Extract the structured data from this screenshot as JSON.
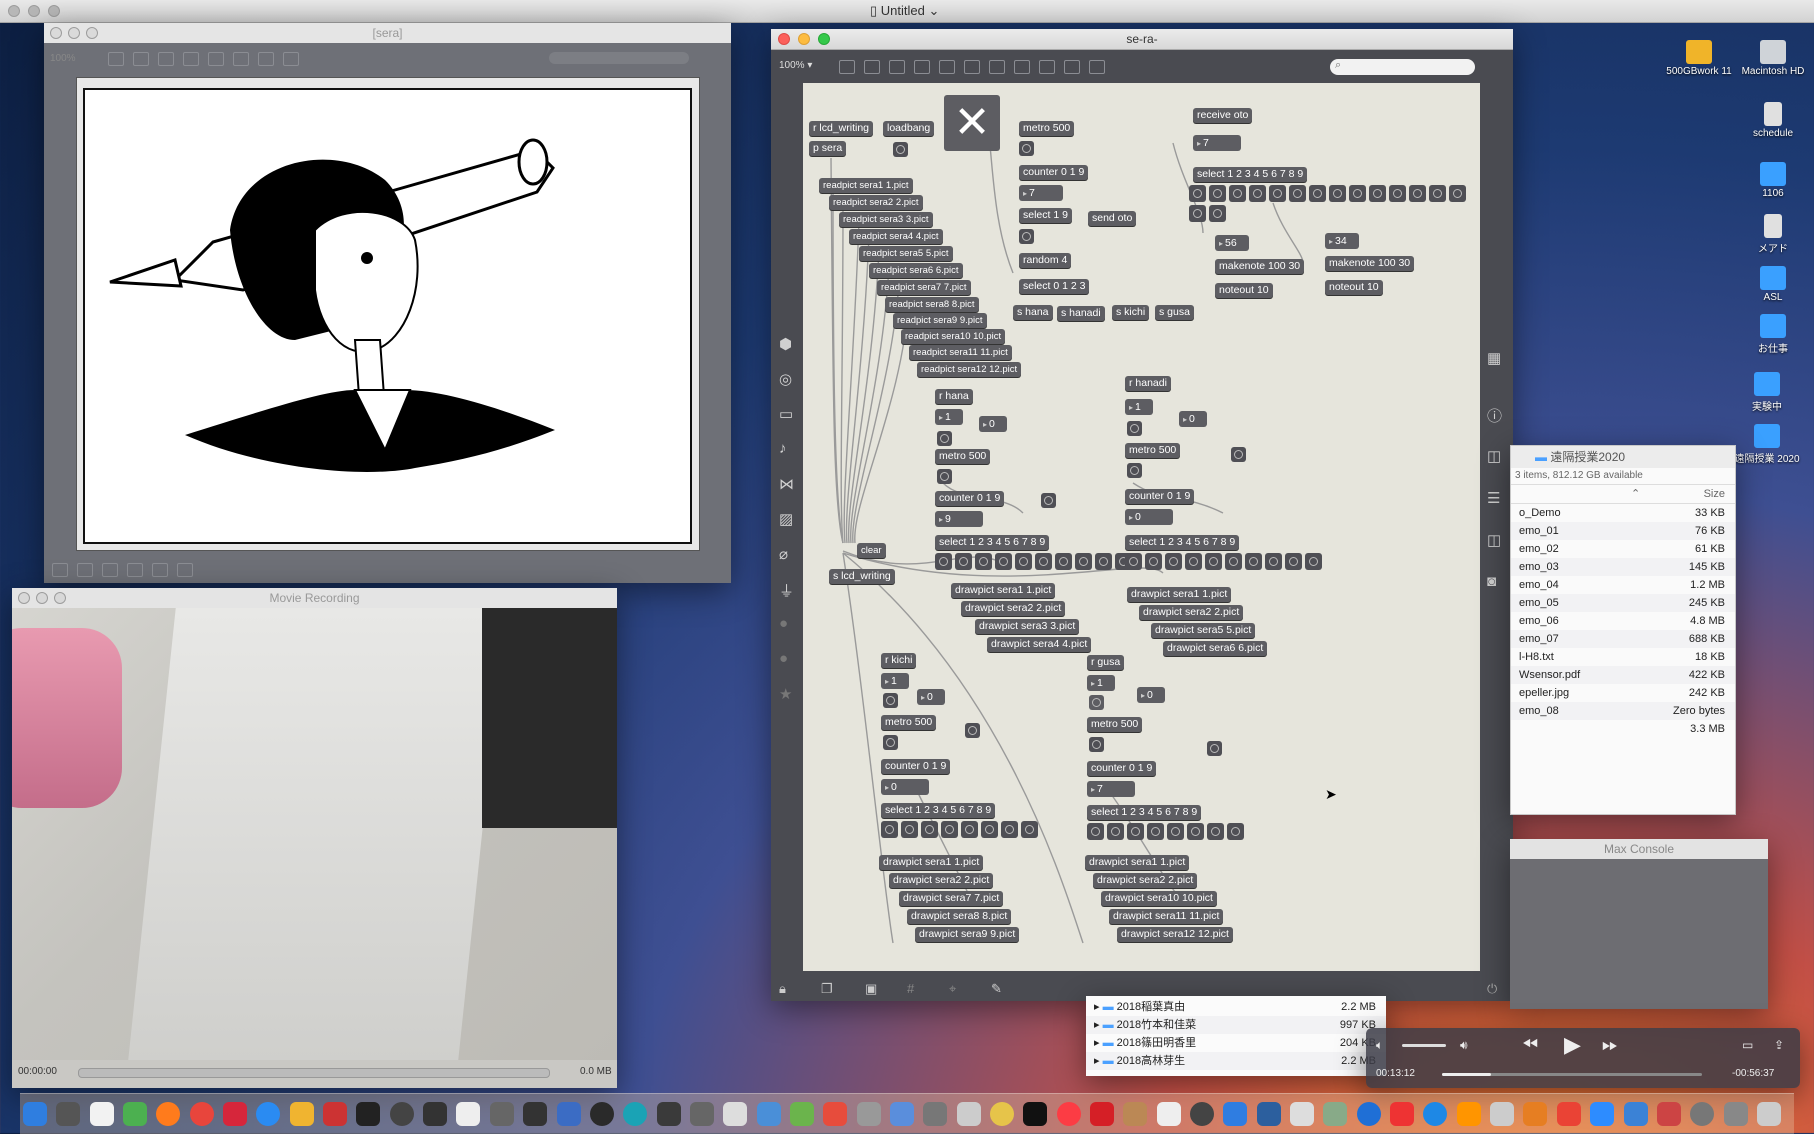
{
  "menubar": {
    "title": "Untitled",
    "chevron": "⌄"
  },
  "sera_window": {
    "title": "[sera]",
    "zoom": "100%"
  },
  "patcher": {
    "title": "se-ra-",
    "zoom": "100% ▾",
    "objects": {
      "r_lcd_writing": "r lcd_writing",
      "p_sera": "p sera",
      "loadbang": "loadbang",
      "metro": "metro 500",
      "counter": "counter 0 1 9",
      "select19": "select 1 9",
      "send_oto": "send oto",
      "random4": "random 4",
      "select0123": "select 0 1 2 3",
      "s_hana": "s hana",
      "s_hanadi": "s hanadi",
      "s_kichi": "s kichi",
      "s_gusa": "s gusa",
      "receive_oto": "receive oto",
      "select_all": "select 1 2 3 4 5 6 7 8 9",
      "makenote": "makenote 100 30",
      "noteout": "noteout 10",
      "r_hana": "r hana",
      "r_hanadi": "r hanadi",
      "r_kichi": "r kichi",
      "r_gusa": "r gusa",
      "clear": "clear",
      "s_lcd_writing": "s lcd_writing"
    },
    "numbers": {
      "n7a": "7",
      "n7b": "7",
      "n56": "56",
      "n34": "34",
      "hana1": "1",
      "hana0": "0",
      "hana9": "9",
      "hanadi1": "1",
      "hanadi0": "0",
      "hanadi0b": "0",
      "kichi1": "1",
      "kichi0": "0",
      "kichi0b": "0",
      "gusa1": "1",
      "gusa0": "0",
      "gusa7": "7"
    },
    "readpicts": [
      "readpict sera1 1.pict",
      "readpict sera2 2.pict",
      "readpict sera3 3.pict",
      "readpict sera4 4.pict",
      "readpict sera5 5.pict",
      "readpict sera6 6.pict",
      "readpict sera7 7.pict",
      "readpict sera8 8.pict",
      "readpict sera9 9.pict",
      "readpict sera10 10.pict",
      "readpict sera11 11.pict",
      "readpict sera12 12.pict"
    ],
    "draw_hana": [
      "drawpict sera1 1.pict",
      "drawpict sera2 2.pict",
      "drawpict sera3 3.pict",
      "drawpict sera4 4.pict"
    ],
    "draw_hanadi": [
      "drawpict sera1 1.pict",
      "drawpict sera2 2.pict",
      "drawpict sera5 5.pict",
      "drawpict sera6 6.pict"
    ],
    "draw_kichi": [
      "drawpict sera1 1.pict",
      "drawpict sera2 2.pict",
      "drawpict sera7 7.pict",
      "drawpict sera8 8.pict",
      "drawpict sera9 9.pict"
    ],
    "draw_gusa": [
      "drawpict sera1 1.pict",
      "drawpict sera2 2.pict",
      "drawpict sera10 10.pict",
      "drawpict sera11 11.pict",
      "drawpict sera12 12.pict"
    ]
  },
  "movie": {
    "title": "Movie Recording",
    "time": "00:00:00",
    "size": "0.0 MB"
  },
  "finder": {
    "title": "遠隔授業2020",
    "status": "3 items, 812.12 GB available",
    "size_header": "Size",
    "rows": [
      {
        "name": "o_Demo",
        "size": "33 KB"
      },
      {
        "name": "emo_01",
        "size": "76 KB"
      },
      {
        "name": "emo_02",
        "size": "61 KB"
      },
      {
        "name": "emo_03",
        "size": "145 KB"
      },
      {
        "name": "emo_04",
        "size": "1.2 MB"
      },
      {
        "name": "emo_05",
        "size": "245 KB"
      },
      {
        "name": "emo_06",
        "size": "4.8 MB"
      },
      {
        "name": "emo_07",
        "size": "688 KB"
      },
      {
        "name": "l-H8.txt",
        "size": "18 KB"
      },
      {
        "name": "Wsensor.pdf",
        "size": "422 KB"
      },
      {
        "name": "epeller.jpg",
        "size": "242 KB"
      },
      {
        "name": "emo_08",
        "size": "Zero bytes"
      },
      {
        "name": "",
        "size": "3.3 MB"
      }
    ]
  },
  "console": {
    "title": "Max Console"
  },
  "finder2": {
    "rows": [
      {
        "name": "2018稲葉真由",
        "size": "2.2 MB"
      },
      {
        "name": "2018竹本和佳菜",
        "size": "997 KB"
      },
      {
        "name": "2018篠田明香里",
        "size": "204 KB"
      },
      {
        "name": "2018高林芽生",
        "size": "2.2 MB"
      }
    ]
  },
  "player": {
    "elapsed": "00:13:12",
    "remaining": "-00:56:37",
    "progress": 0.19
  },
  "desktop": [
    {
      "label": "500GBwork 11",
      "color": "#f0b429"
    },
    {
      "label": "Macintosh HD",
      "color": "#cfd3d8"
    },
    {
      "label": "schedule",
      "color": "#e0e0e0"
    },
    {
      "label": "1106",
      "color": "#3aa0ff"
    },
    {
      "label": "メアド",
      "color": "#e0e0e0"
    },
    {
      "label": "ASL",
      "color": "#3aa0ff"
    },
    {
      "label": "お仕事",
      "color": "#3aa0ff"
    },
    {
      "label": "実験中",
      "color": "#3aa0ff"
    },
    {
      "label": "遠隔授業 2020",
      "color": "#3aa0ff"
    }
  ]
}
